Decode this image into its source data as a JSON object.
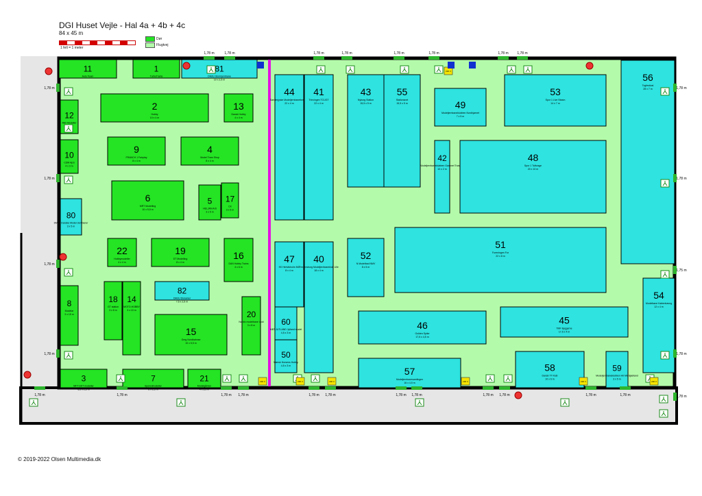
{
  "header": {
    "title": "DGI Huset Vejle - Hal 4a + 4b + 4c",
    "subtitle": "84 x 45 m",
    "scale_note": "1 felt = 1 meter",
    "legend_door": "Dør",
    "legend_escape": "Flugtvej"
  },
  "footer": {
    "copyright": "© 2019-2022  Olsen Multimedia.dk"
  },
  "colors": {
    "hall": "#b3fbaa",
    "green_booth": "#24e424",
    "cyan_booth": "#2ee3e0",
    "wall": "#000000",
    "corridor": "#e6e6e6",
    "divider": "#e312e0",
    "exit": "#2db52d"
  },
  "dimension_label": "1,78 m",
  "dimension_label_right": "1,75 m",
  "power_label": "230 V",
  "booths": [
    {
      "num": "11",
      "name": "Auto Team",
      "color": "green"
    },
    {
      "num": "1",
      "name": "TurboTrains",
      "color": "green"
    },
    {
      "num": "81",
      "name": "DMJU Stormjernbane",
      "size": "10 x 2,5 m",
      "color": "cyan"
    },
    {
      "num": "2",
      "name": "Hobby",
      "size": "10 x 4 m",
      "color": "green"
    },
    {
      "num": "13",
      "name": "Dansk Hobby",
      "size": "4 x 4 m",
      "color": "green"
    },
    {
      "num": "12",
      "name": "Mini Modeller",
      "size": "4 x 3 m",
      "color": "green"
    },
    {
      "num": "10",
      "name": "CDM ApS",
      "size": "4 x 3 m",
      "color": "green"
    },
    {
      "num": "9",
      "name": "FRANCH 1 Fairplay",
      "size": "8 x 4 m",
      "color": "green"
    },
    {
      "num": "4",
      "name": "Model Tram Shop",
      "size": "8 x 4 m",
      "color": "green"
    },
    {
      "num": "6",
      "name": "MRT Modelling",
      "size": "10 x 5,5 m",
      "color": "green"
    },
    {
      "num": "5",
      "name": "HELJAN A/S",
      "size": "3 x 5 m",
      "color": "green"
    },
    {
      "num": "17",
      "name": "CK",
      "size": "3 x 5 m",
      "color": "green"
    },
    {
      "num": "80",
      "name": "DMJU Danske Model Jernbaner",
      "size": "3 x 5 m",
      "color": "cyan"
    },
    {
      "num": "22",
      "name": "Hobbymodeller",
      "size": "4 x 4 m",
      "color": "green"
    },
    {
      "num": "19",
      "name": "DT Modelling",
      "size": "8 x 4 m",
      "color": "green"
    },
    {
      "num": "16",
      "name": "DAN Hobby Trains",
      "size": "4 x 6 m",
      "color": "green"
    },
    {
      "num": "82",
      "name": "DMJU Dioramer",
      "size": "7,5 x 2,5 m",
      "color": "cyan"
    },
    {
      "num": "8",
      "name": "Modelar",
      "size": "3 x 15 m",
      "color": "green"
    },
    {
      "num": "18",
      "name": "GT station",
      "size": "3 x 8 m",
      "color": "green"
    },
    {
      "num": "14",
      "name": "MOTO-HOBBY",
      "size": "3 x 10 m",
      "color": "green"
    },
    {
      "num": "15",
      "name": "Greg Nordbahnse",
      "size": "10 x 5,5 m",
      "color": "green"
    },
    {
      "num": "20",
      "name": "Nordic modelbane Vold",
      "size": "3 x 8 m",
      "color": "green"
    },
    {
      "num": "3",
      "name": "MFT DKT modeller",
      "size": "6,5 x 2,5 m",
      "color": "green"
    },
    {
      "num": "7",
      "name": "Sporedmodeller",
      "size": "8 x 2,5 m",
      "color": "green"
    },
    {
      "num": "21",
      "name": "Modelgården",
      "size": "4 x 2,5 m",
      "color": "green"
    },
    {
      "num": "44",
      "name": "Sønderjyske Modeljernbaneforening",
      "size": "22 x 4 m",
      "color": "cyan"
    },
    {
      "num": "41",
      "name": "Trinvingen TCUGT",
      "size": "22 x 4 m",
      "color": "cyan"
    },
    {
      "num": "43",
      "name": "Nyborg Station",
      "size": "15,5 x 5 m",
      "color": "cyan"
    },
    {
      "num": "55",
      "name": "Stationsnet",
      "size": "15,5 x 5 m",
      "color": "cyan"
    },
    {
      "num": "49",
      "name": "Modeljernbaneklubben Nordhjørnet",
      "size": "7 x 5 m",
      "color": "cyan"
    },
    {
      "num": "53",
      "name": "Spor 1 Live Steam",
      "size": "14 x 7 m",
      "color": "cyan"
    },
    {
      "num": "56",
      "name": "Togfestival",
      "size": "28 x 7 m",
      "color": "cyan"
    },
    {
      "num": "42",
      "name": "Modeljernbaneklubben Gammel Trøstens",
      "size": "10 x 2 m",
      "color": "cyan"
    },
    {
      "num": "48",
      "name": "Spor 1 Tollvrage",
      "size": "20 x 10 m",
      "color": "cyan"
    },
    {
      "num": "47",
      "name": "H0 Herlufsholm MO",
      "size": "8 x 4 m",
      "color": "cyan"
    },
    {
      "num": "52",
      "name": "N Modelbad NMV",
      "size": "8 x 5 m",
      "color": "cyan"
    },
    {
      "num": "51",
      "name": "Foreningen For",
      "size": "22 x 8 m",
      "color": "cyan"
    },
    {
      "num": "40",
      "name": "Fredensborg Modeljernbaneklub Lille",
      "size": "18 x 4 m",
      "color": "cyan"
    },
    {
      "num": "60",
      "name": "MBT JUTLAND Jylland model",
      "size": "4,5 x 3 m",
      "color": "cyan"
    },
    {
      "num": "50",
      "name": "Mærsk Horsens Hobby",
      "size": "4,5 x 3 m",
      "color": "cyan"
    },
    {
      "num": "46",
      "name": "Golden Spike",
      "size": "17,5 x 4,5 m",
      "color": "cyan"
    },
    {
      "num": "45",
      "name": "TMF Byggerne",
      "size": "17,5 x 4 m",
      "color": "cyan"
    },
    {
      "num": "54",
      "name": "Modelbane Københavng",
      "size": "12 x 4 m",
      "color": "cyan"
    },
    {
      "num": "57",
      "name": "Modeljernbanesamlingen",
      "size": "16 x 4,5 m",
      "color": "cyan"
    },
    {
      "num": "58",
      "name": "Dansk TT Klub",
      "size": "10 x 6 m",
      "color": "cyan"
    },
    {
      "num": "59",
      "name": "Modeljernbaneklubben H0 Midtsjælland",
      "size": "3 x 5 m",
      "color": "cyan"
    }
  ]
}
